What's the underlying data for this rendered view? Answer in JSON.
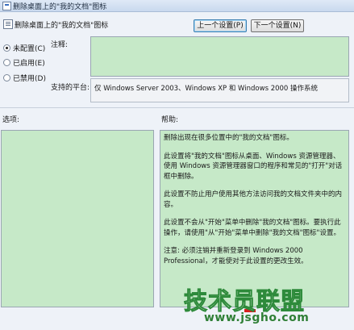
{
  "window": {
    "title": "删除桌面上的\"我的文档\"图标"
  },
  "header": {
    "policy_title": "删除桌面上的\"我的文档\"图标",
    "prev_button": "上一个设置(P)",
    "next_button": "下一个设置(N)"
  },
  "options": {
    "not_configured": "未配置(C)",
    "enabled": "已启用(E)",
    "disabled": "已禁用(D)",
    "selected": "not_configured"
  },
  "labels": {
    "comment": "注释:",
    "supported_on": "支持的平台:",
    "options": "选项:",
    "help": "帮助:"
  },
  "supported_on_value": "仅 Windows Server 2003、Windows XP 和 Windows 2000 操作系统",
  "help": {
    "paragraphs": [
      "删除出现在很多位置中的\"我的文档\"图标。",
      "此设置将\"我的文档\"图标从桌面、Windows 资源管理器、使用 Windows 资源管理器窗口的程序和常见的\"打开\"对话框中删除。",
      "此设置不防止用户使用其他方法访问我的文档文件夹中的内容。",
      "此设置不会从\"开始\"菜单中删除\"我的文档\"图标。要执行此操作，请使用\"从\"开始\"菜单中删除\"我的文档\"图标\"设置。",
      "注意: 必须注销并重新登录到 Windows 2000 Professional，才能使对于此设置的更改生效。"
    ]
  },
  "watermark": {
    "text": "技术员联盟",
    "url": "www.jsgho.com"
  },
  "colors": {
    "panel_green": "#c6e9c8",
    "window_bg": "#eef2f8"
  }
}
